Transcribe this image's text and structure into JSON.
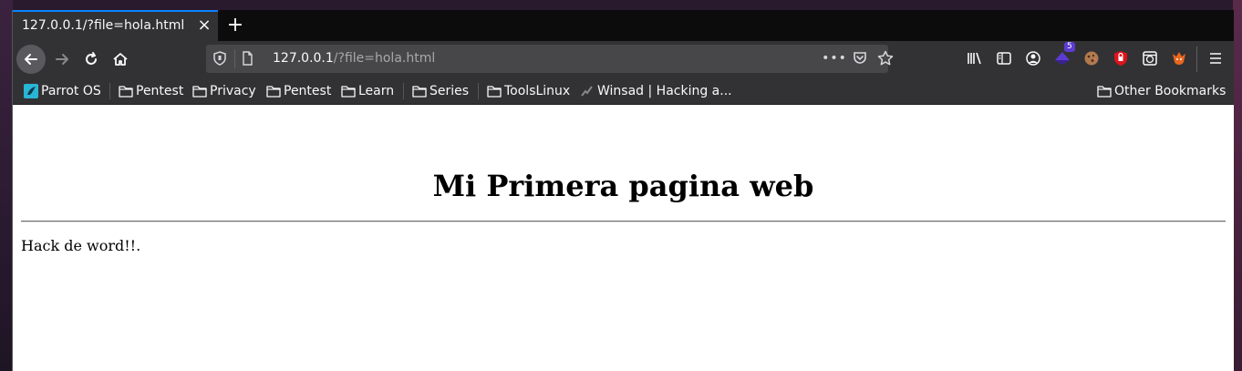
{
  "tab": {
    "title": "127.0.0.1/?file=hola.html"
  },
  "urlbar": {
    "host": "127.0.0.1",
    "path": "/?file=hola.html"
  },
  "toolbar": {
    "extension_badge": "5"
  },
  "bookmarks": {
    "items": [
      {
        "label": "Parrot OS",
        "icon": "parrot-icon"
      },
      {
        "label": "Pentest",
        "icon": "folder-icon"
      },
      {
        "label": "Privacy",
        "icon": "folder-icon"
      },
      {
        "label": "Pentest",
        "icon": "folder-icon"
      },
      {
        "label": "Learn",
        "icon": "folder-icon"
      },
      {
        "label": "Series",
        "icon": "folder-icon"
      },
      {
        "label": "ToolsLinux",
        "icon": "folder-icon"
      },
      {
        "label": "Winsad | Hacking a...",
        "icon": "site-icon"
      }
    ],
    "other": "Other Bookmarks"
  },
  "page": {
    "heading": "Mi Primera pagina web",
    "paragraph": "Hack de word!!."
  },
  "colors": {
    "tab_accent": "#0a84ff",
    "toolbar_bg": "#323234",
    "tabstrip_bg": "#0c0c0d"
  }
}
